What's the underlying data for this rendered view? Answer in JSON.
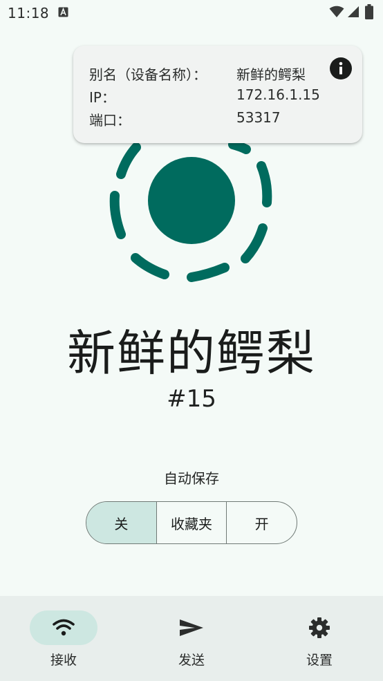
{
  "status_bar": {
    "time": "11:18",
    "icons": [
      "app-notification-icon",
      "wifi-icon",
      "cell-signal-icon",
      "battery-icon"
    ]
  },
  "info_card": {
    "alias_label": "别名（设备名称）：",
    "alias_value": "新鲜的鳄梨",
    "ip_label": "IP：",
    "ip_value": "172.16.1.15",
    "port_label": "端口：",
    "port_value": "53317",
    "icon": "info-icon"
  },
  "device": {
    "name": "新鲜的鳄梨",
    "number": "#15"
  },
  "autosave": {
    "label": "自动保存",
    "options": [
      "关",
      "收藏夹",
      "开"
    ],
    "selected": "关"
  },
  "bottom_nav": {
    "items": [
      {
        "label": "接收",
        "icon": "wifi-icon",
        "active": true
      },
      {
        "label": "发送",
        "icon": "send-icon",
        "active": false
      },
      {
        "label": "设置",
        "icon": "gear-icon",
        "active": false
      }
    ]
  },
  "colors": {
    "background": "#f4faf7",
    "brand_teal": "#006b5e",
    "selected_container": "#cde7e1",
    "nav_background": "#e8eeec",
    "card_background": "#f1f3f2"
  }
}
